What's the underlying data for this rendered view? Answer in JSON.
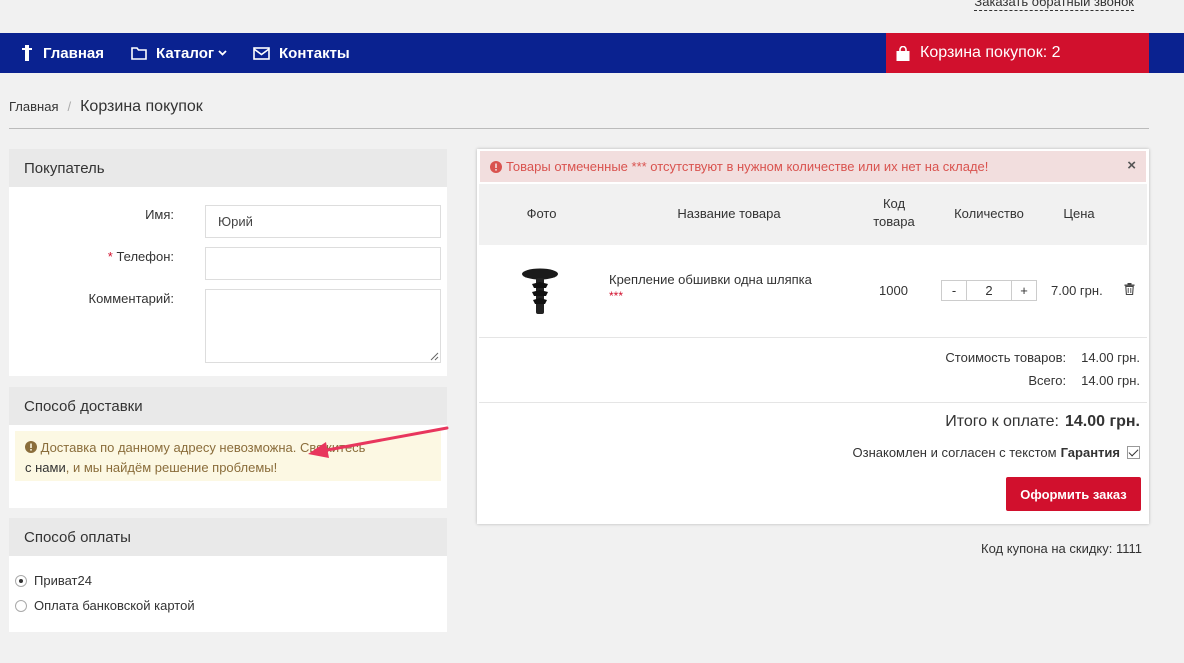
{
  "header": {
    "callback_link": "Заказать обратный звонок"
  },
  "nav": {
    "home": "Главная",
    "catalog": "Каталог",
    "contacts": "Контакты",
    "cart": "Корзина покупок: 2"
  },
  "breadcrumb": {
    "home": "Главная",
    "separator": "/",
    "current": "Корзина покупок"
  },
  "buyer": {
    "title": "Покупатель",
    "name_label": "Имя:",
    "name_value": "Юрий",
    "phone_required_mark": "*",
    "phone_label": "Телефон:",
    "phone_value": "",
    "comment_label": "Комментарий:"
  },
  "delivery": {
    "title": "Способ доставки",
    "warning_text": "Доставка по данному адресу невозможна. Свяжитесь",
    "warning_link": "с нами",
    "warning_rest": ", и мы найдём решение проблемы!"
  },
  "payment": {
    "title": "Способ оплаты",
    "options": [
      {
        "label": "Приват24",
        "checked": true
      },
      {
        "label": "Оплата банковской картой",
        "checked": false
      }
    ]
  },
  "cart": {
    "alert": "Товары отмеченные *** отсутствуют в нужном количестве или их нет на складе!",
    "alert_close": "×",
    "columns": {
      "photo": "Фото",
      "name": "Название товара",
      "code_line1": "Код",
      "code_line2": "товара",
      "qty": "Количество",
      "price": "Цена"
    },
    "items": [
      {
        "name": "Крепление обшивки одна шляпка",
        "mark": "***",
        "code": "1000",
        "qty": "2",
        "qty_minus": "-",
        "qty_plus": "+",
        "price": "7.00 грн."
      }
    ],
    "goods_cost_label": "Стоимость товаров:",
    "goods_cost_value": "14.00 грн.",
    "all_label": "Всего:",
    "all_value": "14.00 грн.",
    "total_label": "Итого к оплате:",
    "total_value": "14.00 грн.",
    "agree_text": "Ознакомлен и согласен с текстом",
    "agree_link": "Гарантия",
    "order_button": "Оформить заказ"
  },
  "coupon": "Код купона на скидку: 1111",
  "colors": {
    "nav_bg": "#0a2290",
    "accent": "#d1102d",
    "warning_bg": "#fcf8e3",
    "alert_bg": "#f2dede"
  }
}
